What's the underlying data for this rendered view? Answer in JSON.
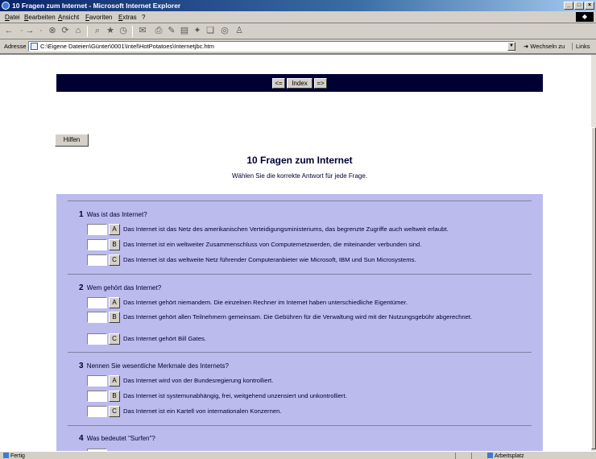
{
  "window": {
    "title": "10 Fragen zum Internet - Microsoft Internet Explorer"
  },
  "menu": [
    "Datei",
    "Bearbeiten",
    "Ansicht",
    "Favoriten",
    "Extras",
    "?"
  ],
  "address": {
    "label": "Adresse",
    "url": "C:\\Eigene Dateien\\Günter\\0001\\Intel\\HotPotatoes\\Internetjbc.htm",
    "go_label": "Wechseln zu",
    "links_label": "Links"
  },
  "nav": {
    "prev": "<=",
    "index": "Index",
    "next": "=>"
  },
  "hint_button": "Hilfen",
  "quiz": {
    "title": "10 Fragen zum Internet",
    "subtitle": "Wählen Sie die korrekte Antwort für jede Frage."
  },
  "questions": [
    {
      "number": "1",
      "text": "Was ist das Internet?",
      "answers": [
        {
          "letter": "A",
          "text": "Das Internet ist das Netz des amerikanischen Verteidigungsministeriums, das begrenzte Zugriffe auch weltweit erlaubt."
        },
        {
          "letter": "B",
          "text": "Das Internet ist ein weltweiter Zusammenschluss von Computernetzwerden, die miteinander verbunden sind."
        },
        {
          "letter": "C",
          "text": "Das Internet ist das weltweite Netz führender Computeranbieter wie Microsoft, IBM und Sun Microsystems."
        }
      ]
    },
    {
      "number": "2",
      "text": "Wem gehört das Internet?",
      "answers": [
        {
          "letter": "A",
          "text": "Das Internet gehört niemandem. Die einzelnen Rechner im Internet haben unterschiedliche Eigentümer."
        },
        {
          "letter": "B",
          "text": "Das Internet gehört allen Teilnehmern gemeinsam. Die Gebühren für die Verwaltung wird mit der Nutzungsgebühr abgerechnet."
        },
        {
          "letter": "C",
          "text": "Das Internet gehört Bill Gates."
        }
      ]
    },
    {
      "number": "3",
      "text": "Nennen Sie wesentliche Merkmale des Internets?",
      "answers": [
        {
          "letter": "A",
          "text": "Das Internet wird von der Bundesregierung kontrolliert."
        },
        {
          "letter": "B",
          "text": "Das Internet ist systemunabhängig, frei, weitgehend unzensiert und unkontrolliert."
        },
        {
          "letter": "C",
          "text": "Das Internet ist ein Kartell von internationalen Konzernen."
        }
      ]
    },
    {
      "number": "4",
      "text": "Was bedeutet \"Surfen\"?",
      "answers": []
    }
  ],
  "status": {
    "text": "Fertig",
    "zone": "Arbeitsplatz"
  }
}
